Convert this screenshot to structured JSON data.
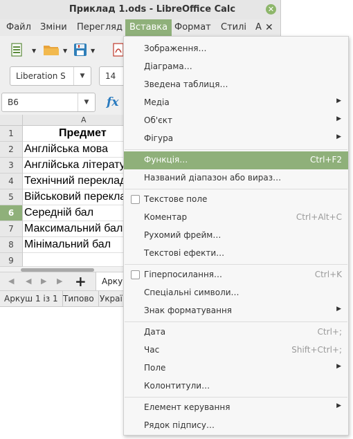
{
  "window": {
    "title": "Приклад 1.ods - LibreOffice Calc",
    "close_glyph": "✕"
  },
  "menubar": {
    "items": [
      "Файл",
      "Зміни",
      "Перегляд",
      "Вставка",
      "Формат",
      "Стилі",
      "А"
    ],
    "active": "Вставка",
    "close_glyph": "✕"
  },
  "toolbar": {
    "icons": [
      "new-document-icon",
      "open-folder-icon",
      "save-icon",
      "export-pdf-icon"
    ],
    "font_name": "Liberation S",
    "font_size": "14",
    "dropdown_glyph": "▼"
  },
  "formula_bar": {
    "name_box": "B6",
    "fx_label": "fx"
  },
  "sheet": {
    "column_header": "A",
    "rows": [
      {
        "num": "1",
        "text": "Предмет"
      },
      {
        "num": "2",
        "text": "Англійська мова"
      },
      {
        "num": "3",
        "text": "Англійська література"
      },
      {
        "num": "4",
        "text": "Технічний переклад"
      },
      {
        "num": "5",
        "text": "Військовий переклад"
      },
      {
        "num": "6",
        "text": "Середній бал"
      },
      {
        "num": "7",
        "text": "Максимальний бал"
      },
      {
        "num": "8",
        "text": "Мінімальний бал"
      },
      {
        "num": "9",
        "text": ""
      }
    ],
    "selected_row": "6"
  },
  "sheet_tabs": {
    "add_glyph": "+",
    "nav_glyphs": [
      "◀",
      "◀",
      "▶",
      "▶"
    ],
    "active_tab": "Аркуш"
  },
  "statusbar": {
    "sheet_info": "Аркуш 1 із 1",
    "page_style": "Типово",
    "language": "Украї"
  },
  "insert_menu": [
    {
      "label": "Зображення…"
    },
    {
      "label": "Діаграма…"
    },
    {
      "label": "Зведена таблиця…"
    },
    {
      "label": "Медіа",
      "submenu": true
    },
    {
      "label": "Об'єкт",
      "submenu": true
    },
    {
      "label": "Фігура",
      "submenu": true
    },
    {
      "separator": true
    },
    {
      "label": "Функція…",
      "shortcut": "Ctrl+F2",
      "highlighted": true
    },
    {
      "label": "Названий діапазон або вираз…"
    },
    {
      "separator": true
    },
    {
      "label": "Текстове поле",
      "checkbox": true
    },
    {
      "label": "Коментар",
      "shortcut": "Ctrl+Alt+C"
    },
    {
      "label": "Рухомий фрейм…"
    },
    {
      "label": "Текстові ефекти…"
    },
    {
      "separator": true
    },
    {
      "label": "Гіперпосилання…",
      "shortcut": "Ctrl+K",
      "checkbox": true
    },
    {
      "label": "Спеціальні символи…"
    },
    {
      "label": "Знак форматування",
      "submenu": true
    },
    {
      "separator": true
    },
    {
      "label": "Дата",
      "shortcut": "Ctrl+;"
    },
    {
      "label": "Час",
      "shortcut": "Shift+Ctrl+;"
    },
    {
      "label": "Поле",
      "submenu": true
    },
    {
      "label": "Колонтитули…"
    },
    {
      "separator": true
    },
    {
      "label": "Елемент керування",
      "submenu": true
    },
    {
      "label": "Рядок підпису…"
    }
  ],
  "submenu_glyph": "▶"
}
